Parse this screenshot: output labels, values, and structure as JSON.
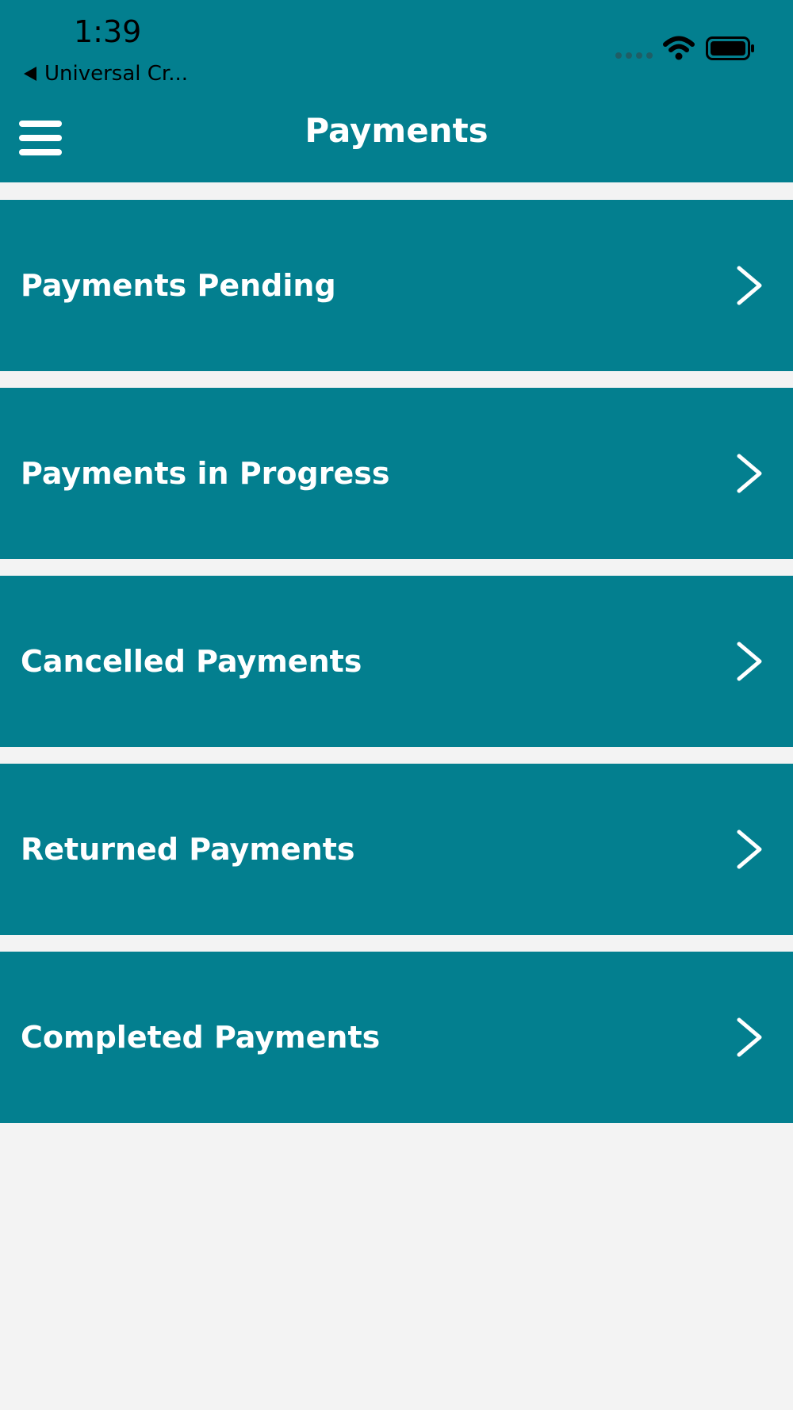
{
  "status_bar": {
    "time": "1:39",
    "back_app": "Universal Cr..."
  },
  "header": {
    "title": "Payments",
    "menu_icon": "hamburger-menu-icon"
  },
  "menu": {
    "items": [
      {
        "label": "Payments Pending",
        "icon": "chevron-right-icon"
      },
      {
        "label": "Payments in Progress",
        "icon": "chevron-right-icon"
      },
      {
        "label": "Cancelled Payments",
        "icon": "chevron-right-icon"
      },
      {
        "label": "Returned Payments",
        "icon": "chevron-right-icon"
      },
      {
        "label": "Completed Payments",
        "icon": "chevron-right-icon"
      }
    ]
  },
  "colors": {
    "primary": "#037f8f",
    "background": "#f3f3f3",
    "text_on_primary": "#ffffff",
    "status_text": "#000000"
  }
}
